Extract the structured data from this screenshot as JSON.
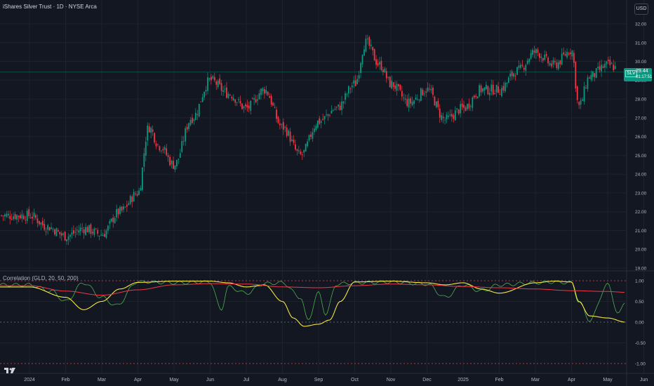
{
  "header": {
    "symbol_title": "iShares Silver Trust · 1D · NYSE Arca",
    "currency_label": "USD"
  },
  "price_tag": {
    "symbol": "SLV",
    "price": "29.44",
    "countdown": "01:17:51"
  },
  "indicator": {
    "title": "Correlation (GLD, 20, 50, 200)"
  },
  "colors": {
    "background": "#131722",
    "grid": "#1e222d",
    "up_candle": "#089981",
    "down_candle": "#f23645",
    "corr_20": "#4caf50",
    "corr_50": "#f5e642",
    "corr_200": "#f23645",
    "price_line": "#089981"
  },
  "icons": {
    "logo": "tradingview-logo-icon"
  },
  "chart_data": [
    {
      "type": "candlestick",
      "title": "iShares Silver Trust · 1D · NYSE Arca",
      "x_tick_labels": [
        "2024",
        "Feb",
        "Mar",
        "Apr",
        "May",
        "Jun",
        "Jul",
        "Aug",
        "Sep",
        "Oct",
        "Nov",
        "Dec",
        "2025",
        "Feb",
        "Mar",
        "Apr",
        "May",
        "Jun"
      ],
      "y_tick_labels": [
        "32.00",
        "31.00",
        "30.00",
        "29.00",
        "28.00",
        "27.00",
        "26.00",
        "25.00",
        "24.00",
        "23.00",
        "22.00",
        "21.00",
        "20.00",
        "19.00"
      ],
      "ylim": [
        19,
        32
      ],
      "last_price": 29.44,
      "close_path": {
        "months": [
          0,
          0.5,
          1,
          1.5,
          2,
          2.5,
          3,
          3.3,
          3.6,
          4,
          4.5,
          5,
          5.5,
          6,
          6.5,
          7,
          7.5,
          8,
          8.5,
          9,
          9.3,
          9.7,
          10,
          10.5,
          11,
          11.5,
          12,
          12.5,
          13,
          13.5,
          14,
          14.5,
          15,
          15.2,
          15.5,
          16,
          16.5
        ],
        "prices": [
          21.8,
          21.2,
          20.7,
          21.1,
          20.8,
          22.0,
          23.0,
          26.5,
          25.5,
          24.5,
          27.0,
          29.0,
          28.3,
          27.5,
          28.5,
          26.5,
          25.0,
          26.8,
          27.5,
          28.8,
          31.0,
          29.8,
          28.8,
          27.8,
          28.5,
          26.9,
          27.5,
          28.5,
          28.5,
          29.5,
          30.5,
          29.8,
          30.6,
          27.6,
          29.2,
          29.8,
          29.44
        ]
      }
    },
    {
      "type": "line",
      "title": "Correlation (GLD, 20, 50, 200)",
      "y_tick_labels": [
        "1.00",
        "0.50",
        "0.00",
        "-0.50",
        "-1.00"
      ],
      "ylim": [
        -1,
        1
      ],
      "series": [
        {
          "name": "20",
          "months": [
            0,
            0.6,
            1,
            1.5,
            2,
            2.4,
            3,
            4,
            5,
            5.3,
            5.5,
            6,
            6.5,
            7,
            7.5,
            7.7,
            8,
            8.2,
            8.5,
            9,
            10,
            11,
            11.5,
            12,
            12.5,
            13,
            14,
            14.5,
            15,
            15.2,
            15.5,
            16,
            16.3,
            16.5
          ],
          "values": [
            0.9,
            0.75,
            0.5,
            0.95,
            0.6,
            0.4,
            0.98,
            0.95,
            0.97,
            0.3,
            0.85,
            0.7,
            0.93,
            0.95,
            0.6,
            0.05,
            0.7,
            0.2,
            0.92,
            0.95,
            0.97,
            0.92,
            0.6,
            0.9,
            0.75,
            0.9,
            0.95,
            0.97,
            0.95,
            0.5,
            0.05,
            0.9,
            0.2,
            0.5
          ]
        },
        {
          "name": "50",
          "months": [
            0,
            1,
            1.5,
            2,
            2.5,
            3,
            4,
            5,
            5.5,
            6,
            6.5,
            7,
            7.3,
            7.6,
            8,
            8.3,
            8.6,
            9,
            10,
            11,
            11.5,
            12,
            12.5,
            13,
            14,
            14.5,
            15,
            15.2,
            15.5,
            16,
            16.5
          ],
          "values": [
            0.85,
            0.6,
            0.3,
            0.5,
            0.8,
            0.96,
            0.99,
            0.99,
            0.95,
            0.85,
            0.9,
            0.5,
            0.1,
            -0.1,
            -0.05,
            0.05,
            0.5,
            0.97,
            0.99,
            0.95,
            0.9,
            0.95,
            0.8,
            0.7,
            0.95,
            0.99,
            0.97,
            0.5,
            0.15,
            0.1,
            0.0
          ]
        },
        {
          "name": "200",
          "months": [
            0,
            1,
            2,
            3,
            4,
            5,
            6,
            7,
            8,
            9,
            10,
            11,
            12,
            13,
            14,
            15,
            16,
            16.5
          ],
          "values": [
            0.88,
            0.75,
            0.65,
            0.78,
            0.9,
            0.93,
            0.92,
            0.85,
            0.83,
            0.88,
            0.92,
            0.9,
            0.86,
            0.83,
            0.8,
            0.76,
            0.74,
            0.72
          ]
        }
      ]
    }
  ]
}
